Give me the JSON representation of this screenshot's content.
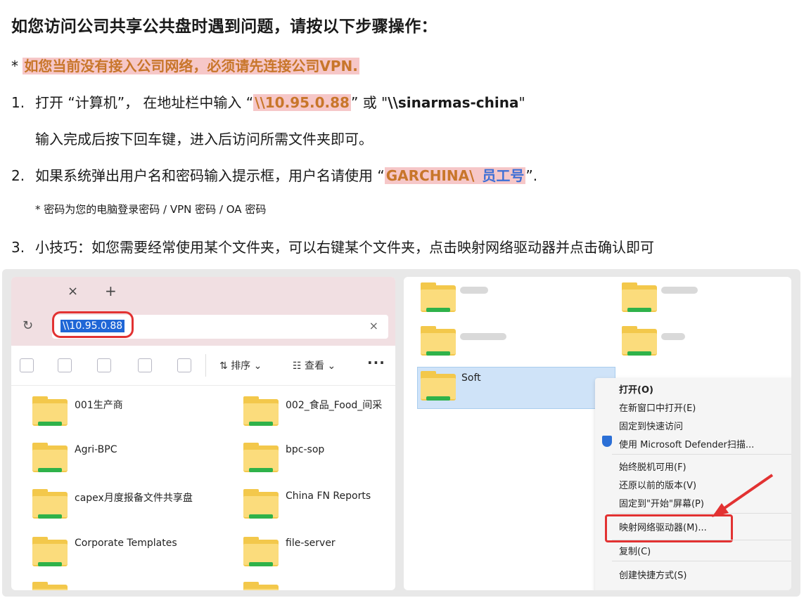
{
  "title": "如您访问公司共享公共盘时遇到问题，请按以下步骤操作：",
  "note": {
    "prefix": "* ",
    "text": "如您当前没有接入公司网络，必须请先连接公司VPN."
  },
  "steps": [
    {
      "num": "1.",
      "line1_a": "打开 “计算机”， 在地址栏中输入 “",
      "ip": "\\\\10.95.0.88",
      "line1_b": "” 或 \"",
      "host": "\\\\sinarmas-china",
      "line1_c": "\"",
      "line2": "输入完成后按下回车键，进入后访问所需文件夹即可。"
    },
    {
      "num": "2.",
      "line1_a": "如果系统弹出用户名和密码输入提示框，用户名请使用 “",
      "user_a": "GARCHINA\\",
      "user_b": " 员工号",
      "line1_b": "”.",
      "sub": "* 密码为您的电脑登录密码 /  VPN 密码 / OA 密码"
    },
    {
      "num": "3.",
      "line1_a": "小技巧：如您需要经常使用某个文件夹，可以右键某个文件夹，点击映射网络驱动器并点击确认即可"
    }
  ],
  "explorer": {
    "tab_close": "×",
    "tab_new": "+",
    "address": "\\\\10.95.0.88",
    "addr_clear": "×",
    "toolbar": {
      "sort": "排序",
      "view": "查看",
      "more": "···"
    },
    "folders": [
      "001生产商",
      "002_食品_Food_间采",
      "Agri-BPC",
      "bpc-sop",
      "capex月度报备文件共享盘",
      "China FN Reports",
      "Corporate Templates",
      "file-server"
    ]
  },
  "right": {
    "selected_folder": "Soft",
    "menu": [
      "打开(O)",
      "在新窗口中打开(E)",
      "固定到快速访问",
      "使用 Microsoft Defender扫描...",
      "始终脱机可用(F)",
      "还原以前的版本(V)",
      "固定到\"开始\"屏幕(P)",
      "映射网络驱动器(M)...",
      "复制(C)",
      "创建快捷方式(S)"
    ]
  }
}
